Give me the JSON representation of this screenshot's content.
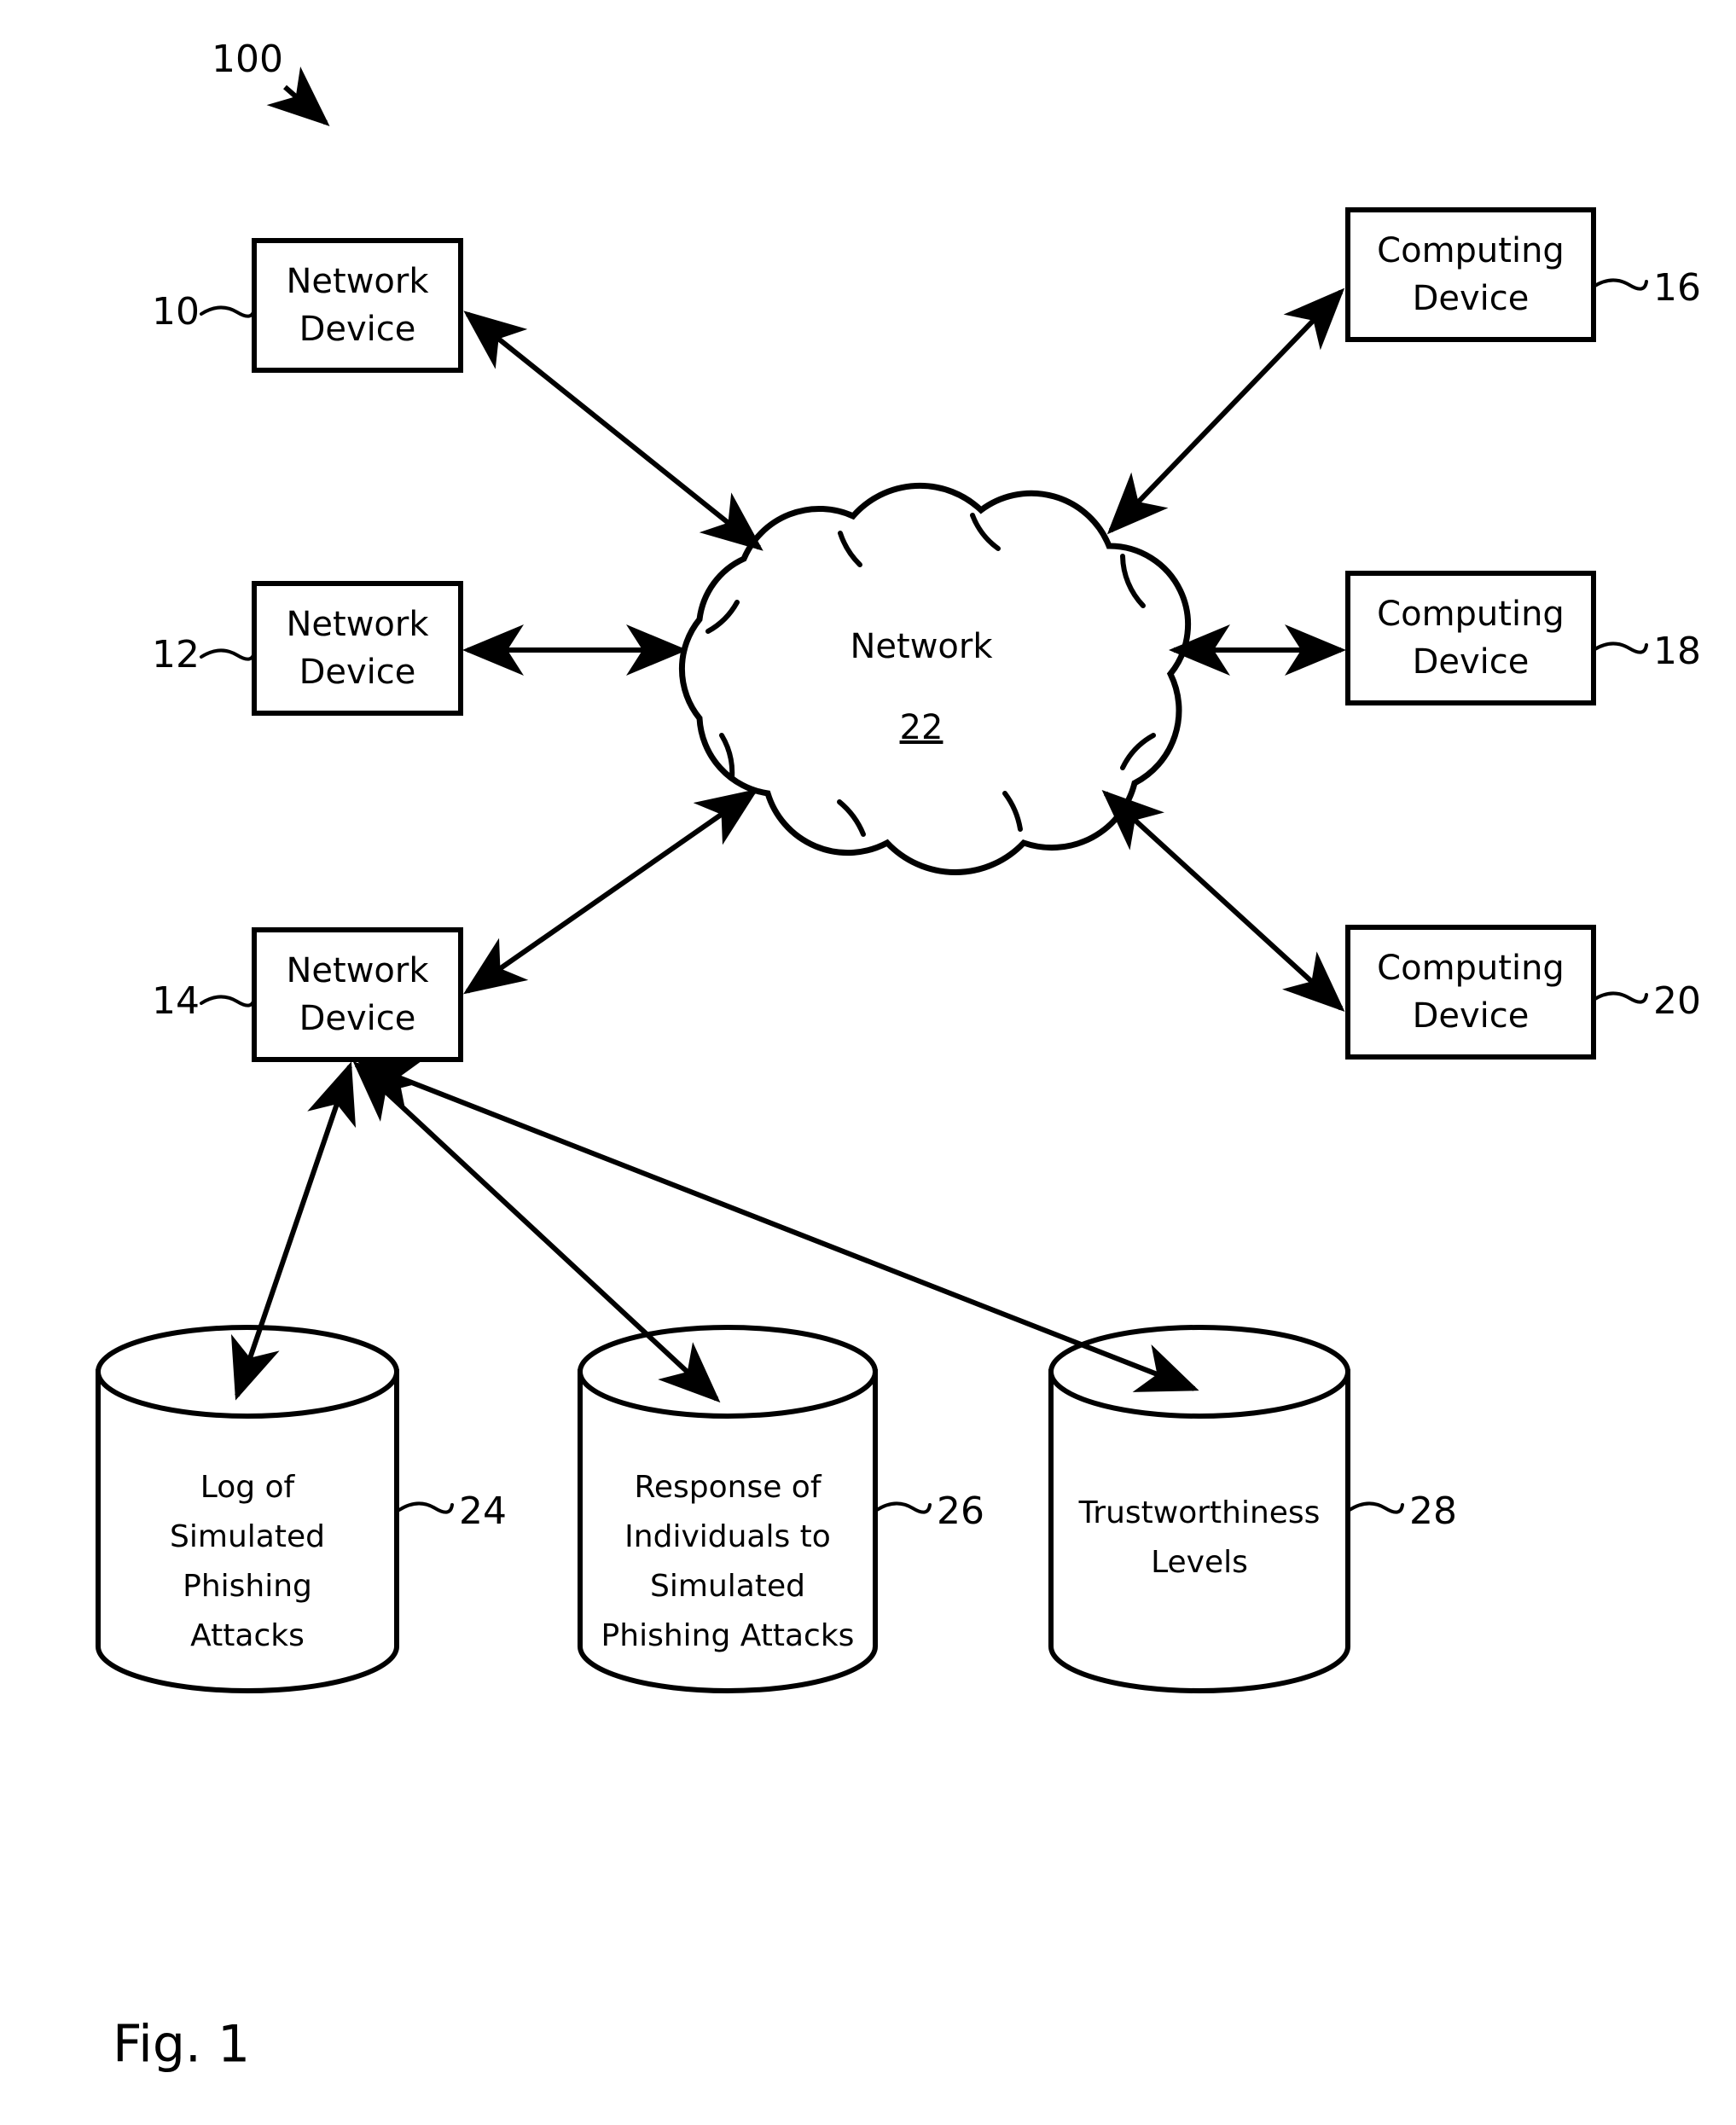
{
  "figure": {
    "caption": "Fig. 1",
    "system_ref": "100"
  },
  "cloud": {
    "label": "Network",
    "ref": "22"
  },
  "network_devices": [
    {
      "label_line1": "Network",
      "label_line2": "Device",
      "ref": "10"
    },
    {
      "label_line1": "Network",
      "label_line2": "Device",
      "ref": "12"
    },
    {
      "label_line1": "Network",
      "label_line2": "Device",
      "ref": "14"
    }
  ],
  "computing_devices": [
    {
      "label_line1": "Computing",
      "label_line2": "Device",
      "ref": "16"
    },
    {
      "label_line1": "Computing",
      "label_line2": "Device",
      "ref": "18"
    },
    {
      "label_line1": "Computing",
      "label_line2": "Device",
      "ref": "20"
    }
  ],
  "databases": [
    {
      "ref": "24",
      "lines": [
        "Log of",
        "Simulated",
        "Phishing",
        "Attacks"
      ]
    },
    {
      "ref": "26",
      "lines": [
        "Response of",
        "Individuals to",
        "Simulated",
        "Phishing Attacks"
      ]
    },
    {
      "ref": "28",
      "lines": [
        "Trustworthiness",
        "Levels"
      ]
    }
  ],
  "colors": {
    "ink": "#000000",
    "paper": "#ffffff"
  }
}
